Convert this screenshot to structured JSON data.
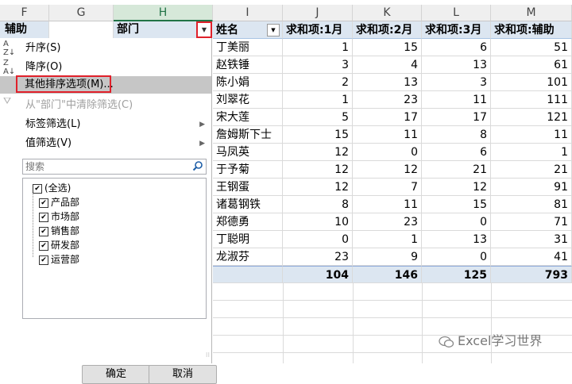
{
  "column_headers": [
    "F",
    "G",
    "H",
    "I",
    "J",
    "K",
    "L",
    "M"
  ],
  "left_header": {
    "f_label": "辅助",
    "h_label": "部门"
  },
  "table": {
    "headers": [
      "姓名",
      "求和项:1月",
      "求和项:2月",
      "求和项:3月",
      "求和项:辅助"
    ],
    "rows": [
      [
        "丁美丽",
        "1",
        "15",
        "6",
        "51"
      ],
      [
        "赵铁锤",
        "3",
        "4",
        "13",
        "61"
      ],
      [
        "陈小娟",
        "2",
        "13",
        "3",
        "101"
      ],
      [
        "刘翠花",
        "1",
        "23",
        "11",
        "111"
      ],
      [
        "宋大莲",
        "5",
        "17",
        "17",
        "121"
      ],
      [
        "詹姆斯下士",
        "15",
        "11",
        "8",
        "11"
      ],
      [
        "马凤英",
        "12",
        "0",
        "6",
        "1"
      ],
      [
        "于予菊",
        "12",
        "12",
        "21",
        "21"
      ],
      [
        "王钢蛋",
        "12",
        "7",
        "12",
        "91"
      ],
      [
        "诸葛钢铁",
        "8",
        "11",
        "15",
        "81"
      ],
      [
        "郑德勇",
        "10",
        "23",
        "0",
        "71"
      ],
      [
        "丁聪明",
        "0",
        "1",
        "13",
        "31"
      ],
      [
        "龙淑芬",
        "23",
        "9",
        "0",
        "41"
      ]
    ],
    "totals": [
      "",
      "104",
      "146",
      "125",
      "793"
    ]
  },
  "menu": {
    "sort_asc": "升序(S)",
    "sort_desc": "降序(O)",
    "more_sort": "其他排序选项(M)...",
    "clear_filter": "从\"部门\"中清除筛选(C)",
    "label_filter": "标签筛选(L)",
    "value_filter": "值筛选(V)",
    "search_placeholder": "搜索",
    "items": [
      "(全选)",
      "产品部",
      "市场部",
      "销售部",
      "研发部",
      "运营部"
    ],
    "ok": "确定",
    "cancel": "取消"
  },
  "watermark": "Excel学习世界"
}
